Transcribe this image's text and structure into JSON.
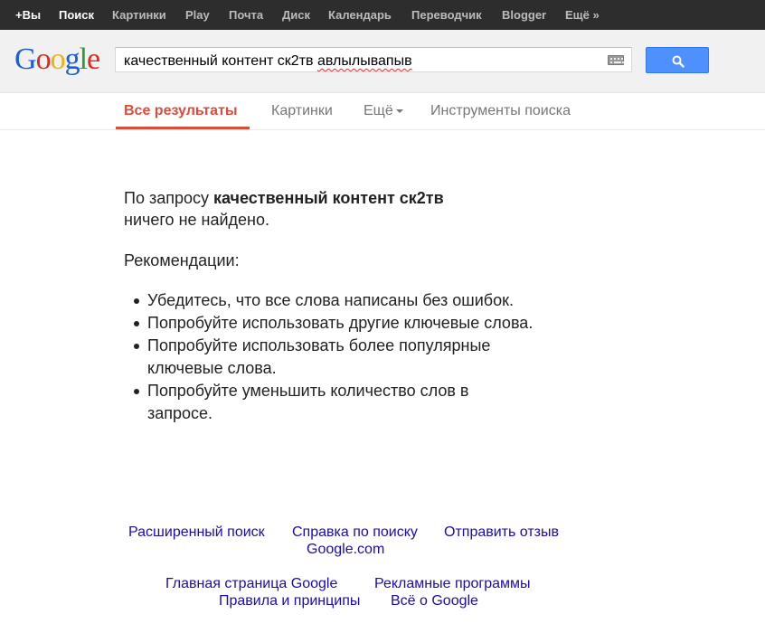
{
  "topbar": {
    "items": [
      "+Вы",
      "Поиск",
      "Картинки",
      "Play",
      "Почта",
      "Диск",
      "Календарь",
      "Переводчик",
      "Blogger",
      "Ещё »"
    ]
  },
  "logo": {
    "letters": [
      "G",
      "o",
      "o",
      "g",
      "l",
      "e"
    ],
    "colors": [
      "#1a5fd6",
      "#d33023",
      "#eeb211",
      "#1a5fd6",
      "#2e9b39",
      "#d33023"
    ]
  },
  "search": {
    "query_main": "качественный контент ск2тв",
    "query_misspelled": "авлылывапыв",
    "button_icon": "magnifier-icon"
  },
  "tabs": {
    "all": "Все результаты",
    "images": "Картинки",
    "more": "Ещё",
    "tools": "Инструменты поиска"
  },
  "no_results": {
    "prefix": "По запросу ",
    "query": "качественный контент ск2тв",
    "suffix": "ничего не найдено."
  },
  "recommendations": {
    "title": "Рекомендации:",
    "items": [
      "Убедитесь, что все слова написаны без ошибок.",
      "Попробуйте использовать другие ключевые слова.",
      "Попробуйте использовать более популярные ключевые слова.",
      "Попробуйте уменьшить количество слов в запросе."
    ]
  },
  "footer": {
    "advanced": "Расширенный поиск",
    "help": "Справка по поиску",
    "feedback": "Отправить отзыв",
    "google_com": "Google.com",
    "home": "Главная страница Google",
    "ads": "Рекламные программы",
    "privacy": "Правила и принципы",
    "about": "Всё о Google"
  },
  "colors": {
    "accent_red": "#dd4b39",
    "link_blue": "#1a0dab",
    "button_blue": "#4d90fe",
    "topbar_bg": "#2d2d2d"
  }
}
